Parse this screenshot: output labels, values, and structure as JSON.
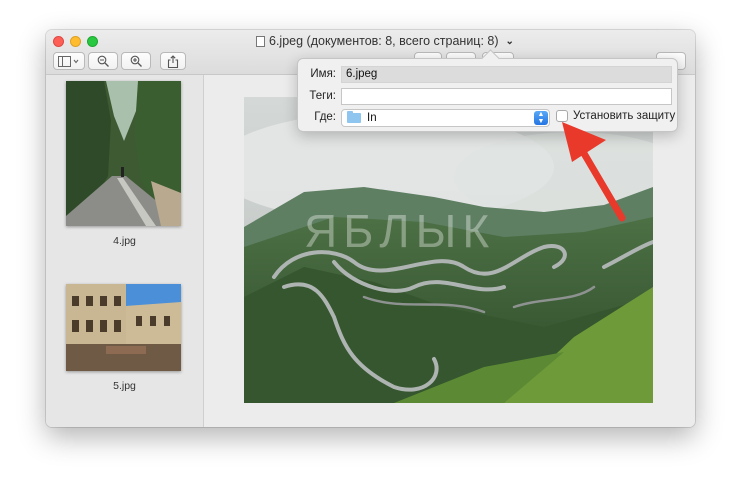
{
  "window": {
    "title": "6.jpeg (документов: 8, всего страниц: 8)"
  },
  "toolbar": {
    "sidebar_toggle_icon": "sidebar-icon",
    "zoom_out_icon": "zoom-out-icon",
    "zoom_in_icon": "zoom-in-icon",
    "share_icon": "share-icon"
  },
  "sidebar": {
    "thumbnails": [
      {
        "label": "4.jpg"
      },
      {
        "label": "5.jpg"
      }
    ]
  },
  "popover": {
    "name_label": "Имя:",
    "name_value": "6.jpeg",
    "tags_label": "Теги:",
    "tags_value": "",
    "where_label": "Где:",
    "where_value": "In",
    "protect_label": "Установить защиту"
  },
  "watermark": "ЯБЛЫК",
  "colors": {
    "annotation_arrow": "#e8392b",
    "popup_accent": "#2f7fe8"
  }
}
